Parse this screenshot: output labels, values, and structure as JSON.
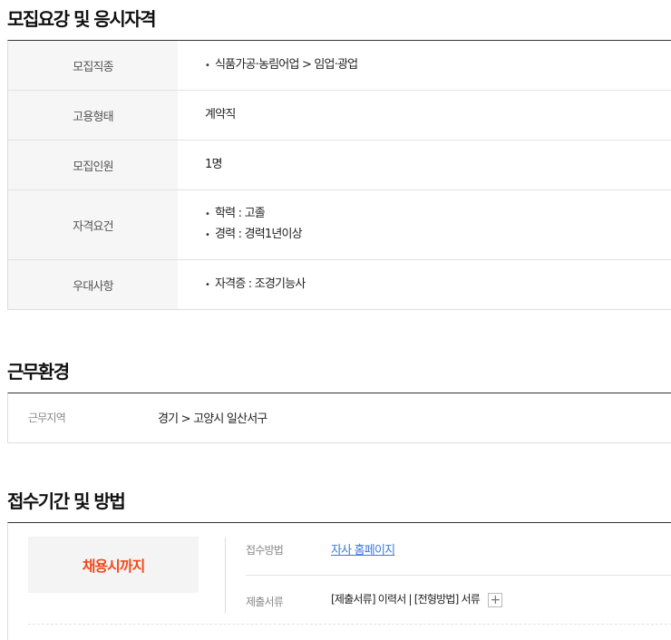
{
  "recruitment": {
    "title": "모집요강 및 응시자격",
    "rows": {
      "job_type": {
        "label": "모집직종",
        "value": "식품가공·농림어업 > 임업·광업"
      },
      "employment": {
        "label": "고용형태",
        "value": "계약직"
      },
      "headcount": {
        "label": "모집인원",
        "value": "1명"
      },
      "qualification": {
        "label": "자격요건",
        "values": [
          "학력 : 고졸",
          "경력 : 경력1년이상"
        ]
      },
      "preference": {
        "label": "우대사항",
        "value": "자격증 : 조경기능사"
      }
    }
  },
  "work_environment": {
    "title": "근무환경",
    "location_label": "근무지역",
    "location_value": "경기 > 고양시 일산서구"
  },
  "application": {
    "title": "접수기간 및 방법",
    "deadline": "채용시까지",
    "method_label": "접수방법",
    "method_value": "자사 홈페이지",
    "documents_label": "제출서류",
    "documents_value": "[제출서류] 이력서 | [전형방법] 서류",
    "expand_symbol": "+"
  },
  "colors": {
    "deadline_text": "#f04a1c",
    "link": "#3b7ae0"
  }
}
